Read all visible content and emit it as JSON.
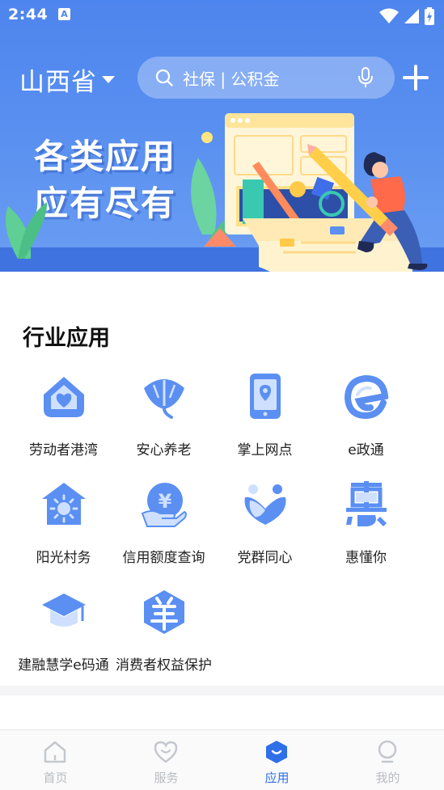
{
  "status_bar": {
    "time": "2:44",
    "notif": "A"
  },
  "topbar": {
    "region": "山西省",
    "search_placeholder": "社保 | 公积金"
  },
  "banner": {
    "line1": "各类应用",
    "line2": "应有尽有"
  },
  "section": {
    "title": "行业应用"
  },
  "apps": [
    {
      "label": "劳动者港湾",
      "icon": "house-heart-icon"
    },
    {
      "label": "安心养老",
      "icon": "ginkgo-leaf-icon"
    },
    {
      "label": "掌上网点",
      "icon": "phone-location-icon"
    },
    {
      "label": "e政通",
      "icon": "e-logo-icon"
    },
    {
      "label": "阳光村务",
      "icon": "sun-house-icon"
    },
    {
      "label": "信用额度查询",
      "icon": "yuan-hand-icon"
    },
    {
      "label": "党群同心",
      "icon": "people-heart-icon"
    },
    {
      "label": "惠懂你",
      "icon": "hui-character-icon"
    },
    {
      "label": "建融慧学e码通",
      "icon": "graduation-cap-icon"
    },
    {
      "label": "消费者权益保护",
      "icon": "shield-yang-icon"
    }
  ],
  "bottom_nav": [
    {
      "label": "首页",
      "icon": "home-icon",
      "active": false
    },
    {
      "label": "服务",
      "icon": "heart-icon",
      "active": false
    },
    {
      "label": "应用",
      "icon": "apps-hexagon-icon",
      "active": true
    },
    {
      "label": "我的",
      "icon": "person-icon",
      "active": false
    }
  ],
  "colors": {
    "primary": "#4d85ee",
    "icon_blue": "#5b8ff2",
    "nav_active": "#2f6fe8",
    "nav_inactive": "#b9bcc3"
  }
}
